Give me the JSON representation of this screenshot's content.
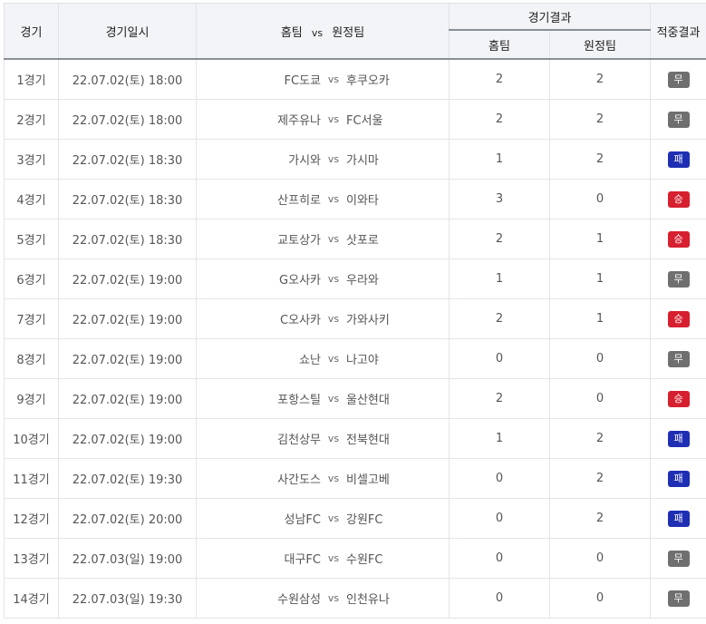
{
  "header": {
    "game": "경기",
    "datetime": "경기일시",
    "home": "홈팀",
    "vs": "vs",
    "away": "원정팀",
    "result": "경기결과",
    "result_home": "홈팀",
    "result_away": "원정팀",
    "prediction": "적중결과"
  },
  "colors": {
    "draw": "#6f6f6f",
    "loss": "#1f2fb3",
    "win": "#d6202f"
  },
  "matches": [
    {
      "game": "1경기",
      "datetime": "22.07.02(토) 18:00",
      "home": "FC도쿄",
      "away": "후쿠오카",
      "home_score": "2",
      "away_score": "2",
      "result": "무",
      "result_type": "draw"
    },
    {
      "game": "2경기",
      "datetime": "22.07.02(토) 18:00",
      "home": "제주유나",
      "away": "FC서울",
      "home_score": "2",
      "away_score": "2",
      "result": "무",
      "result_type": "draw"
    },
    {
      "game": "3경기",
      "datetime": "22.07.02(토) 18:30",
      "home": "가시와",
      "away": "가시마",
      "home_score": "1",
      "away_score": "2",
      "result": "패",
      "result_type": "loss"
    },
    {
      "game": "4경기",
      "datetime": "22.07.02(토) 18:30",
      "home": "산프히로",
      "away": "이와타",
      "home_score": "3",
      "away_score": "0",
      "result": "승",
      "result_type": "win"
    },
    {
      "game": "5경기",
      "datetime": "22.07.02(토) 18:30",
      "home": "교토상가",
      "away": "삿포로",
      "home_score": "2",
      "away_score": "1",
      "result": "승",
      "result_type": "win"
    },
    {
      "game": "6경기",
      "datetime": "22.07.02(토) 19:00",
      "home": "G오사카",
      "away": "우라와",
      "home_score": "1",
      "away_score": "1",
      "result": "무",
      "result_type": "draw"
    },
    {
      "game": "7경기",
      "datetime": "22.07.02(토) 19:00",
      "home": "C오사카",
      "away": "가와사키",
      "home_score": "2",
      "away_score": "1",
      "result": "승",
      "result_type": "win"
    },
    {
      "game": "8경기",
      "datetime": "22.07.02(토) 19:00",
      "home": "쇼난",
      "away": "나고야",
      "home_score": "0",
      "away_score": "0",
      "result": "무",
      "result_type": "draw"
    },
    {
      "game": "9경기",
      "datetime": "22.07.02(토) 19:00",
      "home": "포항스틸",
      "away": "울산현대",
      "home_score": "2",
      "away_score": "0",
      "result": "승",
      "result_type": "win"
    },
    {
      "game": "10경기",
      "datetime": "22.07.02(토) 19:00",
      "home": "김천상무",
      "away": "전북현대",
      "home_score": "1",
      "away_score": "2",
      "result": "패",
      "result_type": "loss"
    },
    {
      "game": "11경기",
      "datetime": "22.07.02(토) 19:30",
      "home": "사간도스",
      "away": "비셀고베",
      "home_score": "0",
      "away_score": "2",
      "result": "패",
      "result_type": "loss"
    },
    {
      "game": "12경기",
      "datetime": "22.07.02(토) 20:00",
      "home": "성남FC",
      "away": "강원FC",
      "home_score": "0",
      "away_score": "2",
      "result": "패",
      "result_type": "loss"
    },
    {
      "game": "13경기",
      "datetime": "22.07.03(일) 19:00",
      "home": "대구FC",
      "away": "수원FC",
      "home_score": "0",
      "away_score": "0",
      "result": "무",
      "result_type": "draw"
    },
    {
      "game": "14경기",
      "datetime": "22.07.03(일) 19:30",
      "home": "수원삼성",
      "away": "인천유나",
      "home_score": "0",
      "away_score": "0",
      "result": "무",
      "result_type": "draw"
    }
  ]
}
